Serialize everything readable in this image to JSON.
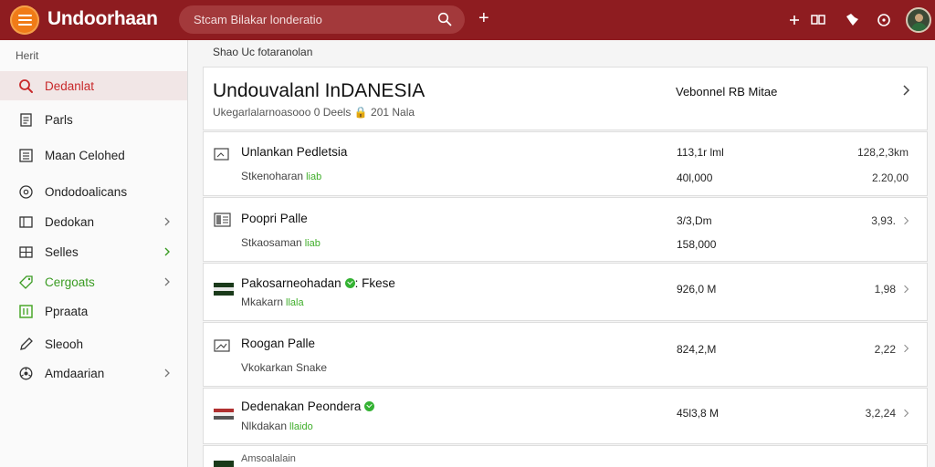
{
  "app": {
    "brand": "Undoorhaan",
    "search_placeholder": "Stcam Bilakar londeratio"
  },
  "colors": {
    "topbar": "#8e1c20",
    "accent": "#c8292b",
    "logo": "#f07b17",
    "green": "#3fae2a"
  },
  "sidebar": {
    "header": "Herit",
    "items": [
      {
        "label": "Dedanlat",
        "icon": "search-icon"
      },
      {
        "label": "Parls",
        "icon": "document-icon"
      },
      {
        "label": "Maan Celohed",
        "icon": "list-icon"
      },
      {
        "label": "Ondodoalicans",
        "icon": "circle-settings-icon"
      },
      {
        "label": "Dedokan",
        "icon": "bookmark-icon"
      },
      {
        "label": "Selles",
        "icon": "grid-icon"
      },
      {
        "label": "Cergoats",
        "icon": "tag-icon"
      },
      {
        "label": "Ppraata",
        "icon": "calendar-icon"
      },
      {
        "label": "Sleooh",
        "icon": "pencil-icon"
      },
      {
        "label": "Amdaarian",
        "icon": "gear-icon"
      }
    ]
  },
  "main": {
    "breadcrumb": "Shao Uc fotaranolan",
    "header": {
      "title": "Undouvalanl InDANESIA",
      "subtitle": "Ukegarlalarnoasooo 0 Deels  🔒 201 Nala",
      "right_label": "Vebonnel RB Mitae"
    },
    "rows": [
      {
        "title": "Unlankan Pedletsia",
        "sub": "Stkenoharan",
        "tag": "liab",
        "v1": "113,1r lml",
        "v2": "40l,000",
        "v3": "128,2,3km",
        "v4": "2.20,00",
        "icon": "file-icon"
      },
      {
        "title": "Poopri Palle",
        "sub": "Stkaosaman",
        "tag": "liab",
        "v1": "3/3,Dm",
        "v2": "158,000",
        "v3": "3,93.",
        "v4": "",
        "icon": "document-icon"
      },
      {
        "title": "Pakosarneohadan",
        "sub": "Mkakarn",
        "tag": "llala",
        "v1": "926,0 M",
        "v2": "",
        "v3": "1,98",
        "v4": "",
        "icon": "flag-icon",
        "suffix": ": Fkese"
      },
      {
        "title": "Roogan Palle",
        "sub": "Vkokarkan Snake",
        "tag": "",
        "v1": "824,2,M",
        "v2": "",
        "v3": "2,22",
        "v4": "",
        "icon": "image-icon"
      },
      {
        "title": "Dedenakan Peondera",
        "sub": "Nlkdakan",
        "tag": "llaido",
        "v1": "45l3,8 M",
        "v2": "",
        "v3": "3,2,24",
        "v4": "",
        "icon": "flag-icon"
      },
      {
        "title": "Amsoalalain",
        "sub": "",
        "tag": "",
        "v1": "",
        "v2": "",
        "v3": "",
        "v4": "",
        "icon": "flag-icon"
      }
    ]
  }
}
